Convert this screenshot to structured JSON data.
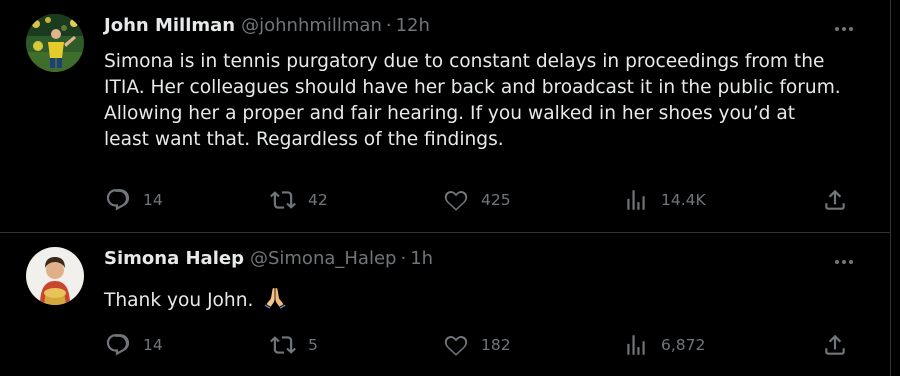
{
  "tweets": [
    {
      "display_name": "John Millman",
      "handle": "@johnhmillman",
      "separator": "·",
      "time": "12h",
      "text": "Simona is in tennis purgatory due to constant delays in proceedings from the ITIA. Her colleagues should have her back and broadcast it in the public forum. Allowing her a proper and fair hearing. If you walked in her shoes you’d at least want that. Regardless of the findings.",
      "replies": "14",
      "retweets": "42",
      "likes": "425",
      "views": "14.4K"
    },
    {
      "display_name": "Simona Halep",
      "handle": "@Simona_Halep",
      "separator": "·",
      "time": "1h",
      "text": "Thank you John.",
      "emoji": "folded-hands",
      "replies": "14",
      "retweets": "5",
      "likes": "182",
      "views": "6,872"
    }
  ],
  "colors": {
    "background": "#000000",
    "text_primary": "#e7e9ea",
    "text_secondary": "#71767b",
    "divider": "#2f3336"
  },
  "icons": [
    "reply-icon",
    "retweet-icon",
    "like-icon",
    "views-icon",
    "share-icon",
    "more-icon"
  ]
}
